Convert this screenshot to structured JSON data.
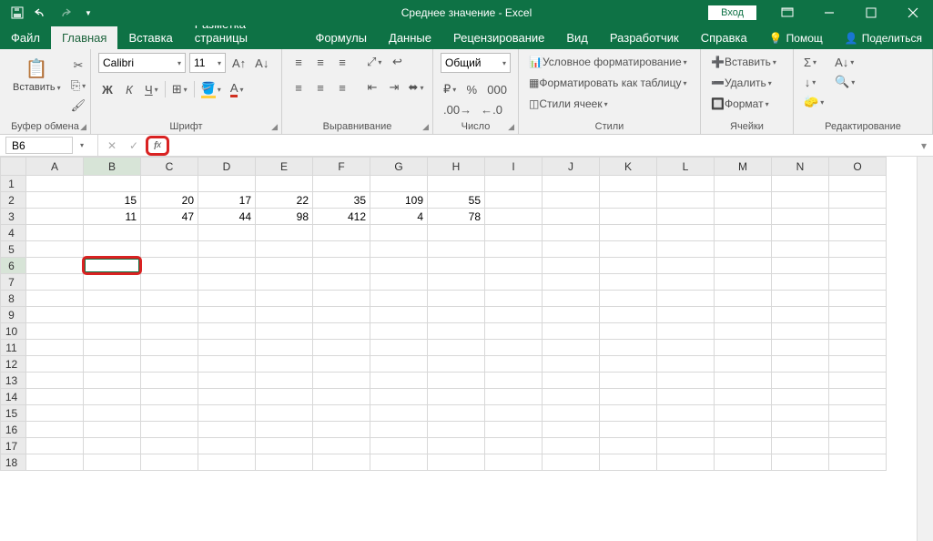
{
  "title": "Среднее значение  -  Excel",
  "login": "Вход",
  "tabs": {
    "file": "Файл",
    "home": "Главная",
    "insert": "Вставка",
    "page": "Разметка страницы",
    "formulas": "Формулы",
    "data": "Данные",
    "review": "Рецензирование",
    "view": "Вид",
    "developer": "Разработчик",
    "help": "Справка",
    "tellme": "Помощ",
    "share": "Поделиться"
  },
  "ribbon": {
    "clipboard": {
      "label": "Буфер обмена",
      "paste": "Вставить"
    },
    "font": {
      "label": "Шрифт",
      "name": "Calibri",
      "size": "11"
    },
    "align": {
      "label": "Выравнивание"
    },
    "number": {
      "label": "Число",
      "format": "Общий"
    },
    "styles": {
      "label": "Стили",
      "cond": "Условное форматирование",
      "table": "Форматировать как таблицу",
      "cell": "Стили ячеек"
    },
    "cells": {
      "label": "Ячейки",
      "insert": "Вставить",
      "delete": "Удалить",
      "format": "Формат"
    },
    "editing": {
      "label": "Редактирование"
    }
  },
  "namebox": "B6",
  "columns": [
    "A",
    "B",
    "C",
    "D",
    "E",
    "F",
    "G",
    "H",
    "I",
    "J",
    "K",
    "L",
    "M",
    "N",
    "O"
  ],
  "rows": [
    "1",
    "2",
    "3",
    "4",
    "5",
    "6",
    "7",
    "8",
    "9",
    "10",
    "11",
    "12",
    "13",
    "14",
    "15",
    "16",
    "17",
    "18"
  ],
  "cells": {
    "2": {
      "B": "15",
      "C": "20",
      "D": "17",
      "E": "22",
      "F": "35",
      "G": "109",
      "H": "55"
    },
    "3": {
      "B": "11",
      "C": "47",
      "D": "44",
      "E": "98",
      "F": "412",
      "G": "4",
      "H": "78"
    }
  },
  "selected": {
    "row": "6",
    "col": "B"
  }
}
